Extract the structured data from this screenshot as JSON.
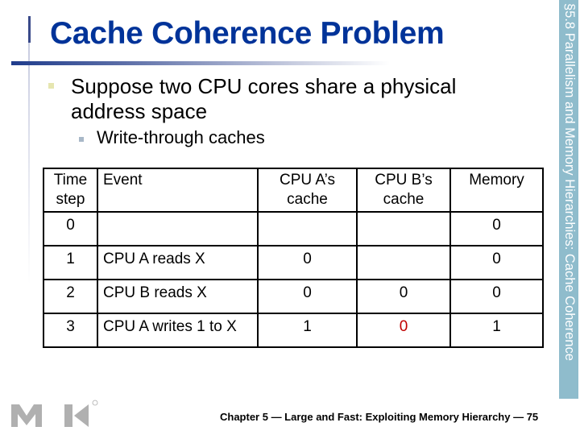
{
  "title": "Cache Coherence Problem",
  "bullets": [
    {
      "text": "Suppose two CPU cores share a physical address space",
      "sub": [
        "Write-through caches"
      ]
    }
  ],
  "table": {
    "headers": [
      "Time step",
      "Event",
      "CPU A’s cache",
      "CPU B’s cache",
      "Memory"
    ],
    "rows": [
      [
        "0",
        "",
        "",
        "",
        "0"
      ],
      [
        "1",
        "CPU A reads X",
        "0",
        "",
        "0"
      ],
      [
        "2",
        "CPU B reads X",
        "0",
        "0",
        "0"
      ],
      [
        "3",
        "CPU A writes 1 to X",
        "1",
        "0",
        "1"
      ]
    ],
    "highlight": {
      "row": 3,
      "col": 3,
      "color": "#c00000"
    }
  },
  "side_label": "§5.8 Parallelism and Memory Hierarchies: Cache Coherence",
  "footer": "Chapter 5 — Large and Fast: Exploiting Memory Hierarchy — 75",
  "logo": {
    "text": "MK",
    "icon": "mk-logo"
  },
  "colors": {
    "title": "#003399",
    "sidebar": "#8fbccc",
    "highlight": "#c00000"
  }
}
